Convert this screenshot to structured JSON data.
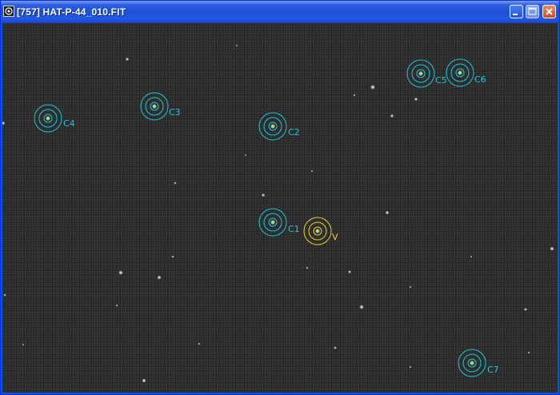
{
  "window": {
    "title": "[757] HAT-P-44_010.FIT",
    "icons": {
      "app": "app-icon",
      "minimize": "minimize-icon",
      "maximize": "maximize-icon",
      "close": "close-icon"
    }
  },
  "colors": {
    "titlebar": "#2358e3",
    "sky": "#2a2a2a",
    "comparison_aperture": "#19c8d8",
    "variable_aperture": "#e8d21a",
    "star_core": "#9cff6a"
  },
  "image": {
    "apertures": [
      {
        "id": "C1",
        "label": "C1",
        "kind": "comparison"
      },
      {
        "id": "C2",
        "label": "C2",
        "kind": "comparison"
      },
      {
        "id": "C3",
        "label": "C3",
        "kind": "comparison"
      },
      {
        "id": "C4",
        "label": "C4",
        "kind": "comparison"
      },
      {
        "id": "C5",
        "label": "C5",
        "kind": "comparison"
      },
      {
        "id": "C6",
        "label": "C6",
        "kind": "comparison"
      },
      {
        "id": "C7",
        "label": "C7",
        "kind": "comparison"
      },
      {
        "id": "V",
        "label": "V",
        "kind": "variable"
      }
    ]
  }
}
